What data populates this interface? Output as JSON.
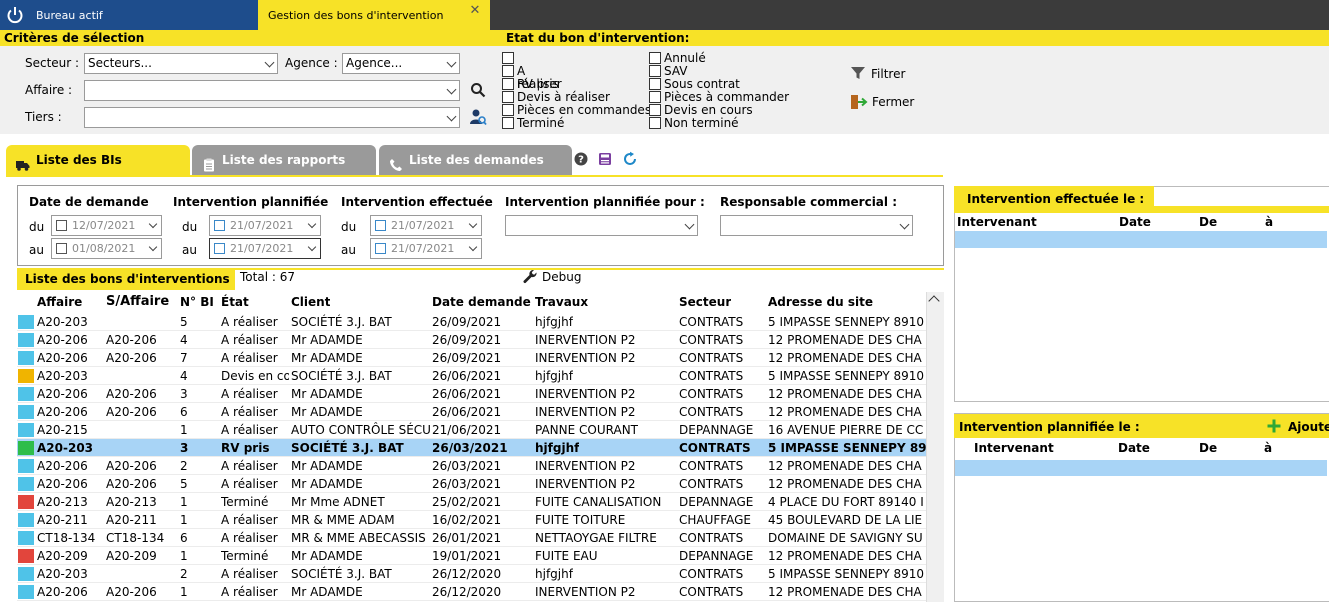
{
  "tabs": {
    "bureau": "Bureau actif",
    "gestion": "Gestion des bons d'intervention",
    "close": "✕"
  },
  "criteria": {
    "title": "Critères de sélection",
    "secteur_label": "Secteur :",
    "secteur_value": "Secteurs...",
    "agence_label": "Agence :",
    "agence_value": "Agence...",
    "affaire_label": "Affaire :",
    "tiers_label": "Tiers :"
  },
  "etat": {
    "title": "Etat du bon d'intervention:",
    "col1": [
      "A réaliser",
      "RV pris",
      "Devis à réaliser",
      "Pièces en commandes",
      "Terminé"
    ],
    "col2": [
      "Annulé",
      "SAV",
      "Sous contrat",
      "Pièces à commander",
      "Devis en cours",
      "Non terminé"
    ]
  },
  "actions": {
    "filtrer": "Filtrer",
    "fermer": "Fermer"
  },
  "list_tabs": {
    "bis": "Liste des BIs",
    "rapports": "Liste des rapports",
    "demandes": "Liste des demandes"
  },
  "filters": {
    "date_demande": "Date de demande",
    "planifiee": "Intervention plannifiée",
    "effectuee": "Intervention effectuée",
    "planifiee_pour": "Intervention plannifiée pour :",
    "responsable": "Responsable commercial :",
    "du": "du",
    "au": "au",
    "demande_du": "12/07/2021",
    "demande_au": "01/08/2021",
    "planif_du": "21/07/2021",
    "planif_au": "21/07/2021",
    "effect_du": "21/07/2021",
    "effect_au": "21/07/2021"
  },
  "list": {
    "title": "Liste des bons d'interventions",
    "total": "Total : 67",
    "debug": "Debug",
    "columns": [
      "Affaire",
      "S/Affaire",
      "N° BI",
      "État",
      "Client",
      "Date demande",
      "Travaux",
      "Secteur",
      "Adresse du site"
    ],
    "rows": [
      {
        "color": "#4fc3e8",
        "affaire": "A20-203",
        "saffaire": "",
        "nbi": "5",
        "etat": "A réaliser",
        "client": "SOCIÉTÉ 3.J. BAT",
        "date": "26/09/2021",
        "travaux": "hjfgjhf",
        "secteur": "CONTRATS",
        "adresse": "5 IMPASSE SENNEPY 8910"
      },
      {
        "color": "#4fc3e8",
        "affaire": "A20-206",
        "saffaire": "A20-206",
        "nbi": "4",
        "etat": "A réaliser",
        "client": "Mr ADAMDE",
        "date": "26/09/2021",
        "travaux": "INERVENTION P2",
        "secteur": "CONTRATS",
        "adresse": "12 PROMENADE DES CHA"
      },
      {
        "color": "#4fc3e8",
        "affaire": "A20-206",
        "saffaire": "A20-206",
        "nbi": "7",
        "etat": "A réaliser",
        "client": "Mr ADAMDE",
        "date": "26/09/2021",
        "travaux": "INERVENTION P2",
        "secteur": "CONTRATS",
        "adresse": "12 PROMENADE DES CHA"
      },
      {
        "color": "#f0b400",
        "affaire": "A20-203",
        "saffaire": "",
        "nbi": "4",
        "etat": "Devis en co",
        "client": "SOCIÉTÉ 3.J. BAT",
        "date": "26/06/2021",
        "travaux": "hjfgjhf",
        "secteur": "CONTRATS",
        "adresse": "5 IMPASSE SENNEPY 8910"
      },
      {
        "color": "#4fc3e8",
        "affaire": "A20-206",
        "saffaire": "A20-206",
        "nbi": "3",
        "etat": "A réaliser",
        "client": "Mr ADAMDE",
        "date": "26/06/2021",
        "travaux": "INERVENTION P2",
        "secteur": "CONTRATS",
        "adresse": "12 PROMENADE DES CHA"
      },
      {
        "color": "#4fc3e8",
        "affaire": "A20-206",
        "saffaire": "A20-206",
        "nbi": "6",
        "etat": "A réaliser",
        "client": "Mr ADAMDE",
        "date": "26/06/2021",
        "travaux": "INERVENTION P2",
        "secteur": "CONTRATS",
        "adresse": "12 PROMENADE DES CHA"
      },
      {
        "color": "#4fc3e8",
        "affaire": "A20-215",
        "saffaire": "",
        "nbi": "1",
        "etat": "A réaliser",
        "client": "AUTO CONTRÔLE SÉCUF",
        "date": "21/06/2021",
        "travaux": "PANNE COURANT",
        "secteur": "DEPANNAGE",
        "adresse": "16 AVENUE PIERRE DE CC"
      },
      {
        "color": "#2ebd4a",
        "affaire": "A20-203",
        "saffaire": "",
        "nbi": "3",
        "etat": "RV pris",
        "client": "SOCIÉTÉ 3.J. BAT",
        "date": "26/03/2021",
        "travaux": "hjfgjhf",
        "secteur": "CONTRATS",
        "adresse": "5 IMPASSE SENNEPY 8910",
        "selected": true
      },
      {
        "color": "#4fc3e8",
        "affaire": "A20-206",
        "saffaire": "A20-206",
        "nbi": "2",
        "etat": "A réaliser",
        "client": "Mr ADAMDE",
        "date": "26/03/2021",
        "travaux": "INERVENTION P2",
        "secteur": "CONTRATS",
        "adresse": "12 PROMENADE DES CHA"
      },
      {
        "color": "#4fc3e8",
        "affaire": "A20-206",
        "saffaire": "A20-206",
        "nbi": "5",
        "etat": "A réaliser",
        "client": "Mr ADAMDE",
        "date": "26/03/2021",
        "travaux": "INERVENTION P2",
        "secteur": "CONTRATS",
        "adresse": "12 PROMENADE DES CHA"
      },
      {
        "color": "#e2453c",
        "affaire": "A20-213",
        "saffaire": "A20-213",
        "nbi": "1",
        "etat": "Terminé",
        "client": "Mr Mme ADNET",
        "date": "25/02/2021",
        "travaux": "FUITE CANALISATION",
        "secteur": "DEPANNAGE",
        "adresse": "4 PLACE DU FORT 89140 I"
      },
      {
        "color": "#4fc3e8",
        "affaire": "A20-211",
        "saffaire": "A20-211",
        "nbi": "1",
        "etat": "A réaliser",
        "client": "MR & MME ADAM",
        "date": "16/02/2021",
        "travaux": "FUITE TOITURE",
        "secteur": "CHAUFFAGE",
        "adresse": "45 BOULEVARD DE LA LIE"
      },
      {
        "color": "#4fc3e8",
        "affaire": "CT18-134",
        "saffaire": "CT18-134",
        "nbi": "6",
        "etat": "A réaliser",
        "client": "MR & MME ABECASSIS",
        "date": "26/01/2021",
        "travaux": "NETTAOYGAE FILTRE",
        "secteur": "CONTRATS",
        "adresse": "DOMAINE DE SAVIGNY SU"
      },
      {
        "color": "#e2453c",
        "affaire": "A20-209",
        "saffaire": "A20-209",
        "nbi": "1",
        "etat": "Terminé",
        "client": "Mr ADAMDE",
        "date": "19/01/2021",
        "travaux": "FUITE  EAU",
        "secteur": "DEPANNAGE",
        "adresse": "12 PROMENADE DES CHA"
      },
      {
        "color": "#4fc3e8",
        "affaire": "A20-203",
        "saffaire": "",
        "nbi": "2",
        "etat": "A réaliser",
        "client": "SOCIÉTÉ 3.J. BAT",
        "date": "26/12/2020",
        "travaux": "hjfgjhf",
        "secteur": "CONTRATS",
        "adresse": "5 IMPASSE SENNEPY 8910"
      },
      {
        "color": "#4fc3e8",
        "affaire": "A20-206",
        "saffaire": "A20-206",
        "nbi": "1",
        "etat": "A réaliser",
        "client": "Mr ADAMDE",
        "date": "26/12/2020",
        "travaux": "INERVENTION P2",
        "secteur": "CONTRATS",
        "adresse": "12 PROMENADE DES CHA"
      }
    ]
  },
  "effectuee_panel": {
    "title": "Intervention effectuée le :",
    "columns": [
      "Intervenant",
      "Date",
      "De",
      "à"
    ]
  },
  "planifiee_panel": {
    "title": "Intervention plannifiée le :",
    "add": "Ajoute",
    "columns": [
      "Intervenant",
      "Date",
      "De",
      "à"
    ]
  }
}
